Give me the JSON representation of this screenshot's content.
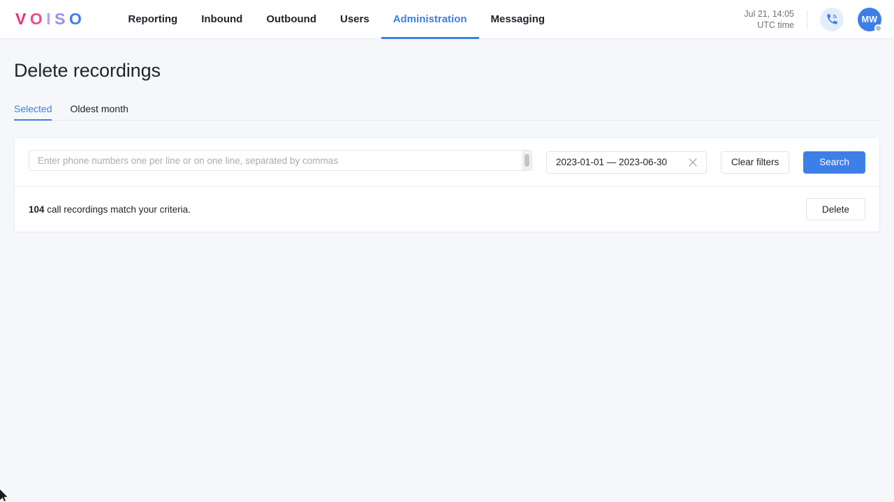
{
  "brand": {
    "logo_letters": [
      "V",
      "O",
      "I",
      "S",
      "O"
    ],
    "colors": {
      "accent_blue": "#3d7fe8",
      "logo_pink": "#f02e74",
      "logo_violet": "#9b8cf2",
      "page_bg": "#f5f7fa"
    }
  },
  "nav": {
    "items": [
      {
        "label": "Reporting",
        "active": false
      },
      {
        "label": "Inbound",
        "active": false
      },
      {
        "label": "Outbound",
        "active": false
      },
      {
        "label": "Users",
        "active": false
      },
      {
        "label": "Administration",
        "active": true
      },
      {
        "label": "Messaging",
        "active": false
      }
    ]
  },
  "header": {
    "clock_date": "Jul 21, 14:05",
    "clock_zone": "UTC time",
    "phone_icon": "phone-call-icon",
    "avatar_initials": "MW",
    "avatar_status": "offline"
  },
  "page": {
    "title": "Delete recordings",
    "tabs": [
      {
        "label": "Selected",
        "active": true
      },
      {
        "label": "Oldest month",
        "active": false
      }
    ]
  },
  "filters": {
    "phones_placeholder": "Enter phone numbers one per line or on one line, separated by commas",
    "phones_value": "",
    "date_range": "2023-01-01 — 2023-06-30",
    "clear_date_icon": "close-icon",
    "clear_filters_label": "Clear filters",
    "search_label": "Search"
  },
  "results": {
    "count": "104",
    "message": " call recordings match your criteria.",
    "delete_label": "Delete"
  }
}
